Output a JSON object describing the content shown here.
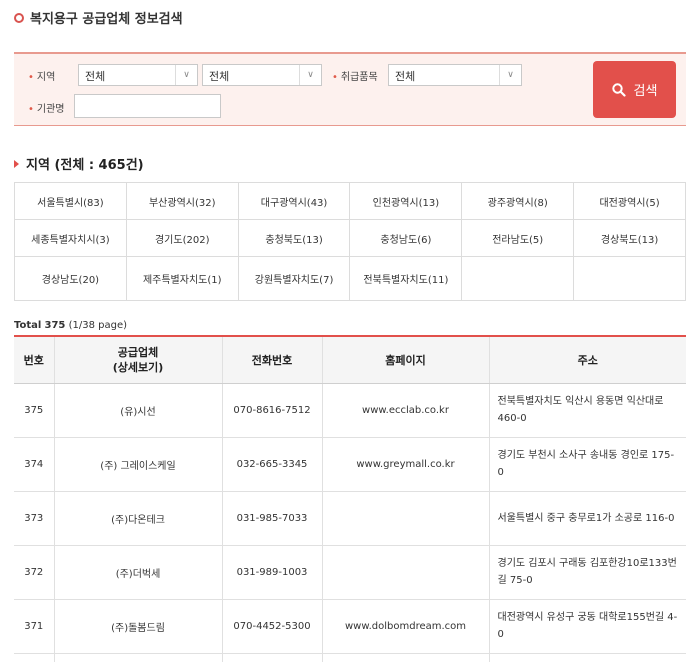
{
  "page": {
    "title": "복지용구 공급업체 정보검색"
  },
  "search": {
    "region_label": "지역",
    "region_select1": "전체",
    "region_select2": "전체",
    "item_label": "취급품목",
    "item_select": "전체",
    "org_label": "기관명",
    "org_value": "",
    "button_label": "검색",
    "dot": "•"
  },
  "region_section": {
    "title": "지역 (전체 : 465건)",
    "rows": [
      [
        "서울특별시(83)",
        "부산광역시(32)",
        "대구광역시(43)",
        "인천광역시(13)",
        "광주광역시(8)",
        "대전광역시(5)"
      ],
      [
        "세종특별자치시(3)",
        "경기도(202)",
        "충청북도(13)",
        "충청남도(6)",
        "전라남도(5)",
        "경상북도(13)"
      ],
      [
        "경상남도(20)",
        "제주특별자치도(1)",
        "강원특별자치도(7)",
        "전북특별자치도(11)",
        "",
        ""
      ]
    ]
  },
  "results": {
    "total_label": "Total",
    "total_count": "375",
    "page_info": "(1/38 page)",
    "headers": [
      "번호",
      "공급업체\n(상세보기)",
      "전화번호",
      "홈페이지",
      "주소"
    ],
    "rows": [
      {
        "no": "375",
        "name": "(유)시선",
        "phone": "070-8616-7512",
        "web": "www.ecclab.co.kr",
        "addr": "전북특별자치도 익산시 용동면 익산대로 460-0"
      },
      {
        "no": "374",
        "name": "(주) 그레이스케일",
        "phone": "032-665-3345",
        "web": "www.greymall.co.kr",
        "addr": "경기도 부천시 소사구 송내동 경인로 175-0"
      },
      {
        "no": "373",
        "name": "(주)다온테크",
        "phone": "031-985-7033",
        "web": "",
        "addr": "서울특별시 중구 충무로1가 소공로 116-0"
      },
      {
        "no": "372",
        "name": "(주)더벅세",
        "phone": "031-989-1003",
        "web": "",
        "addr": "경기도 김포시 구래동 김포한강10로133번길 75-0"
      },
      {
        "no": "371",
        "name": "(주)돌봄드림",
        "phone": "070-4452-5300",
        "web": "www.dolbomdream.com",
        "addr": "대전광역시 유성구 궁동 대학로155번길 4-0"
      }
    ]
  },
  "colors": {
    "accent": "#e2504b",
    "search_bg": "#fdf1ee"
  }
}
